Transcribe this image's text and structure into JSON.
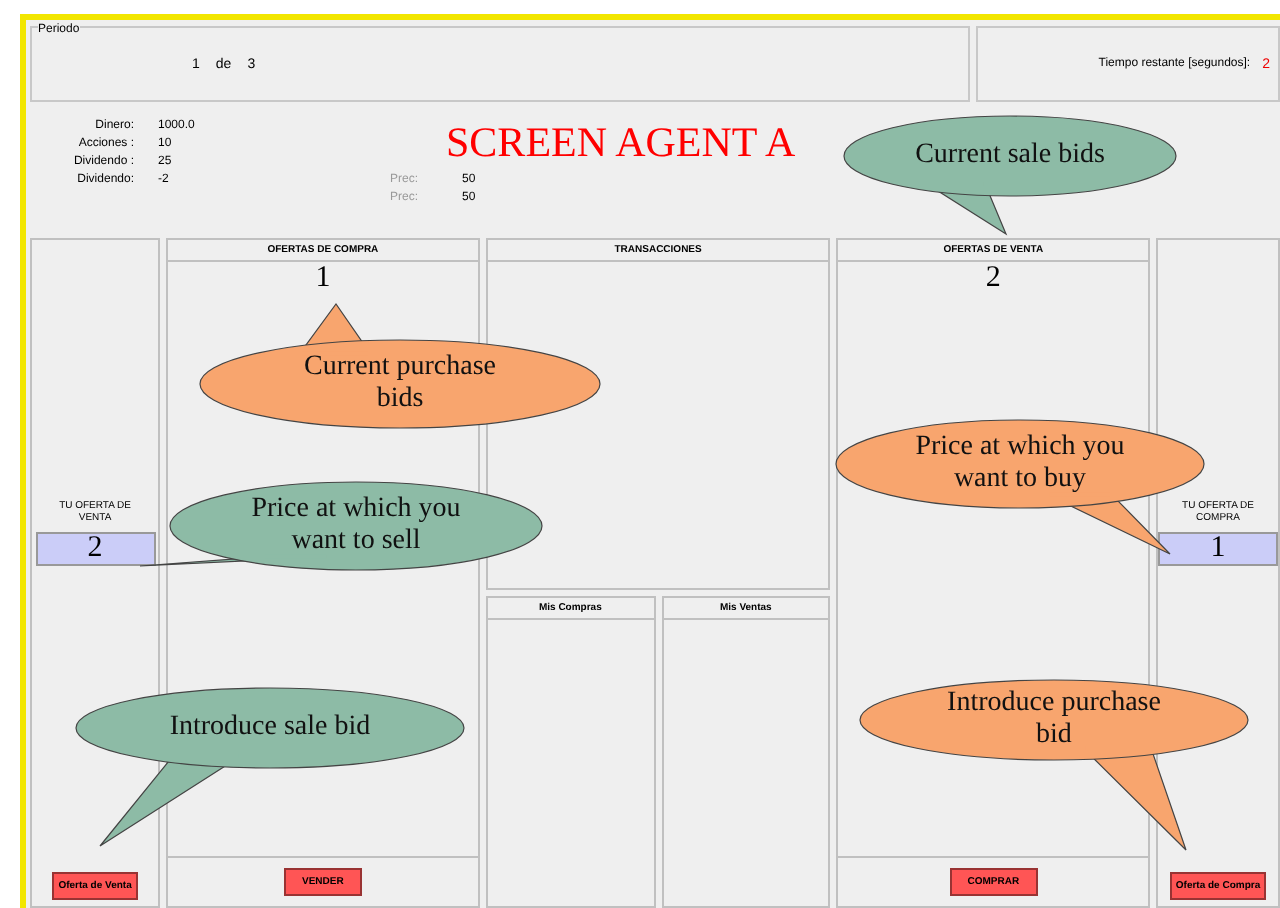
{
  "period": {
    "legend": "Periodo",
    "current": "1",
    "of": "de",
    "total": "3"
  },
  "timer": {
    "label": "Tiempo restante [segundos]:",
    "value": "2"
  },
  "title": "SCREEN AGENT A",
  "account": [
    {
      "label": "Dinero:",
      "value": "1000.0"
    },
    {
      "label": "Acciones :",
      "value": "10"
    },
    {
      "label": "Dividendo :",
      "value": "25"
    },
    {
      "label": "Dividendo:",
      "value": "-2"
    }
  ],
  "prices": [
    {
      "label": "Prec:",
      "value": "50"
    },
    {
      "label": "Prec:",
      "value": "50"
    }
  ],
  "sell_offer": {
    "label": "TU OFERTA DE VENTA",
    "value": "2",
    "button": "Oferta de Venta"
  },
  "purchase_bids": {
    "header": "OFERTAS DE COMPRA",
    "items": [
      "1"
    ],
    "button": "VENDER"
  },
  "transactions": {
    "header": "TRANSACCIONES",
    "my_purchases": "Mis Compras",
    "my_sales": "Mis Ventas"
  },
  "sale_bids": {
    "header": "OFERTAS DE VENTA",
    "items": [
      "2"
    ],
    "button": "COMPRAR"
  },
  "buy_offer": {
    "label": "TU OFERTA DE COMPRA",
    "value": "1",
    "button": "Oferta de Compra"
  },
  "callouts": [
    {
      "kind": "sale",
      "text": "Current sale bids"
    },
    {
      "kind": "purchase",
      "text": "Current purchase bids"
    },
    {
      "kind": "sale",
      "text": "Price at which you want to sell"
    },
    {
      "kind": "purchase",
      "text": "Price at which you want to buy"
    },
    {
      "kind": "sale",
      "text": "Introduce sale bid"
    },
    {
      "kind": "purchase",
      "text": "Introduce purchase bid"
    }
  ]
}
